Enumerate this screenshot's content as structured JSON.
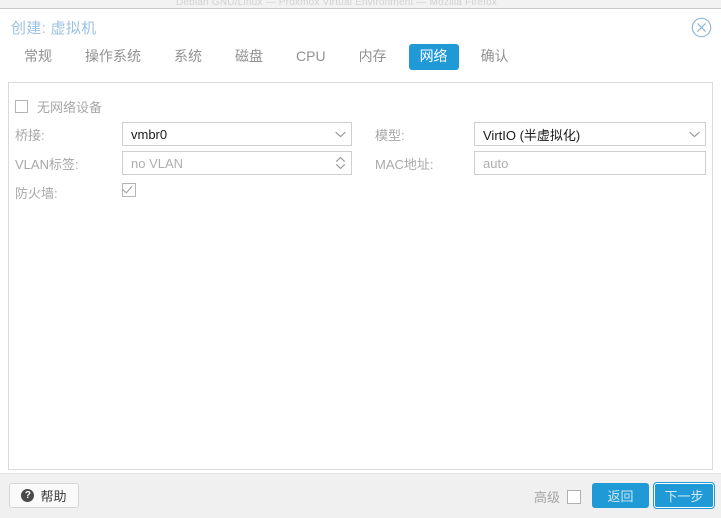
{
  "background": {
    "ghost_text": "Debian GNU/Linux — Proxmox Virtual Environment — Mozilla Firefox"
  },
  "dialog": {
    "title": "创建: 虚拟机",
    "close_icon": "close-circle-icon"
  },
  "tabs": [
    {
      "label": "常规",
      "active": false
    },
    {
      "label": "操作系统",
      "active": false
    },
    {
      "label": "系统",
      "active": false
    },
    {
      "label": "磁盘",
      "active": false
    },
    {
      "label": "CPU",
      "active": false
    },
    {
      "label": "内存",
      "active": false
    },
    {
      "label": "网络",
      "active": true
    },
    {
      "label": "确认",
      "active": false
    }
  ],
  "form": {
    "no_network_device": {
      "label": "无网络设备",
      "checked": false
    },
    "bridge": {
      "label": "桥接:",
      "value": "vmbr0",
      "is_placeholder": false,
      "trigger_icon": "chevron-down-icon"
    },
    "vlan_tag": {
      "label": "VLAN标签:",
      "value": "no VLAN",
      "is_placeholder": true,
      "trigger_icon": "spinner-updown-icon"
    },
    "firewall": {
      "label": "防火墙:",
      "checked": true
    },
    "model": {
      "label": "模型:",
      "value": "VirtIO (半虚拟化)",
      "is_placeholder": false,
      "trigger_icon": "chevron-down-icon"
    },
    "mac_address": {
      "label": "MAC地址:",
      "value": "auto",
      "is_placeholder": true
    }
  },
  "footer": {
    "help_label": "帮助",
    "help_icon": "question-mark-icon",
    "advanced_label": "高级",
    "advanced_checked": false,
    "back_label": "返回",
    "next_label": "下一步"
  },
  "colors": {
    "accent": "#1f9ad6",
    "title_text": "#9dc2e0",
    "label_text": "#a8a8a8",
    "value_text": "#1a1a1a",
    "placeholder_text": "#aeaeae",
    "panel_border": "#d9d9d9",
    "footer_bg": "#f0f0f0"
  }
}
